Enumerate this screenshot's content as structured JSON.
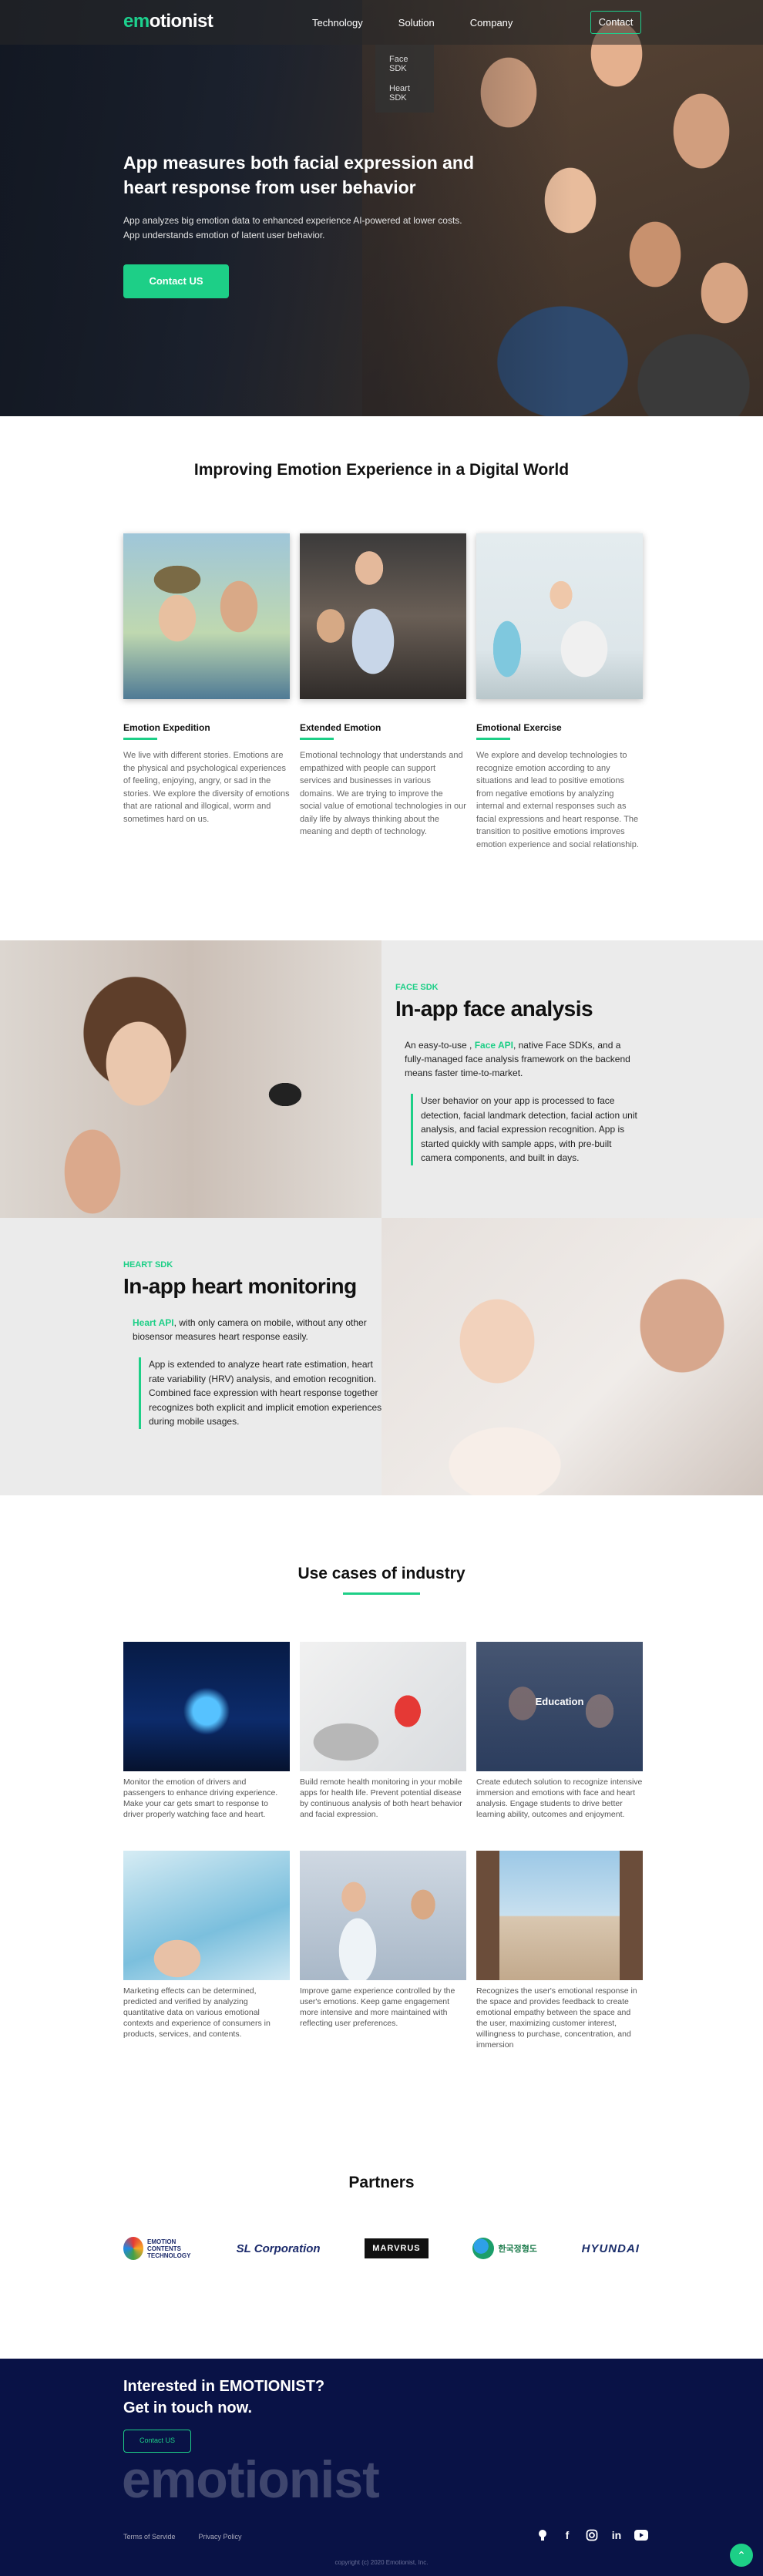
{
  "nav": {
    "logo_prefix": "em",
    "logo_suffix": "otionist",
    "links": [
      "Technology",
      "Solution",
      "Company"
    ],
    "contact": "Contact",
    "dropdown": [
      "Face SDK",
      "Heart SDK"
    ]
  },
  "hero": {
    "title": "App measures both facial expression and heart response from user behavior",
    "desc": "App analyzes big emotion data to enhanced experience AI-powered at lower costs. App understands emotion of latent user behavior.",
    "button": "Contact US"
  },
  "improve": {
    "title": "Improving Emotion Experience in a Digital World",
    "cards": [
      {
        "title": "Emotion Expedition",
        "text": "We live with different stories. Emotions are the physical and psychological experiences of feeling, enjoying, angry, or sad in the stories. We explore the diversity of emotions  that are rational and illogical, worm and sometimes hard on us."
      },
      {
        "title": "Extended Emotion",
        "text": "Emotional technology that understands and empathized with people can support services and businesses in various domains. We are trying to improve the social value of emotional technologies in our daily life  by always thinking about the meaning and depth of technology."
      },
      {
        "title": "Emotional Exercise",
        "text": "We explore and develop technologies to recognize emotion according to any situations and lead to positive emotions from negative emotions by analyzing internal and external responses such as facial expressions and heart response. The transition to positive emotions improves emotion experience and social relationship."
      }
    ]
  },
  "face": {
    "label": "FACE SDK",
    "title": "In-app face analysis",
    "intro_pre": "An easy-to-use , ",
    "intro_hl": "Face API",
    "intro_post": ", native Face SDKs, and a fully-managed face analysis framework on the backend means faster time-to-market.",
    "quote": "User behavior on your app is processed to face detection, facial landmark detection, facial action unit analysis, and facial expression recognition. App is started quickly with sample apps, with pre-built camera components, and built in days."
  },
  "heart": {
    "label": "HEART SDK",
    "title": "In-app heart monitoring",
    "intro_hl": "Heart API",
    "intro_post": ", with only camera on mobile, without any other biosensor measures heart response easily.",
    "quote": "App is extended to analyze heart rate estimation, heart rate variability (HRV) analysis, and emotion recognition. Combined face expression with heart response together recognizes both explicit and implicit emotion experiences during mobile usages."
  },
  "usecases": {
    "title": "Use cases of industry",
    "items": [
      {
        "caption": "",
        "text": "Monitor the emotion of drivers and passengers to enhance driving experience. Make your car gets smart to response to driver properly watching face and heart."
      },
      {
        "caption": "",
        "text": "Build remote health monitoring in your mobile apps for health life. Prevent potential disease by continuous analysis of both heart behavior and facial expression."
      },
      {
        "caption": "Education",
        "text": "Create edutech solution to recognize intensive immersion and emotions with face and heart analysis. Engage students to drive better learning ability, outcomes and enjoyment."
      },
      {
        "caption": "",
        "text": "Marketing effects can be determined, predicted and verified by analyzing quantitative data on various emotional contexts and experience of consumers in products, services, and contents."
      },
      {
        "caption": "",
        "text": "Improve game experience controlled by the user's emotions. Keep game engagement more intensive and more maintained with reflecting user preferences."
      },
      {
        "caption": "",
        "text": "Recognizes the user's emotional response in the space and provides feedback to create emotional empathy between the space and the user, maximizing customer interest, willingness to purchase, concentration, and immersion"
      }
    ]
  },
  "partners": {
    "title": "Partners",
    "logos": [
      "EMOTION CONTENTS TECHNOLOGY",
      "SL Corporation",
      "MARVRUS",
      "한국정형도",
      "HYUNDAI"
    ]
  },
  "footer": {
    "headline1": "Interested in EMOTIONIST?",
    "headline2": "Get in touch now.",
    "button": "Contact US",
    "biglogo": "emotionist",
    "links": [
      "Terms of Servide",
      "Privacy Policy"
    ],
    "social": [
      "github-icon",
      "facebook-icon",
      "instagram-icon",
      "linkedin-icon",
      "youtube-icon"
    ],
    "copyright": "copyright (c) 2020 Emotionist, Inc.",
    "accent": "#1dcf87",
    "background": "#091246"
  }
}
